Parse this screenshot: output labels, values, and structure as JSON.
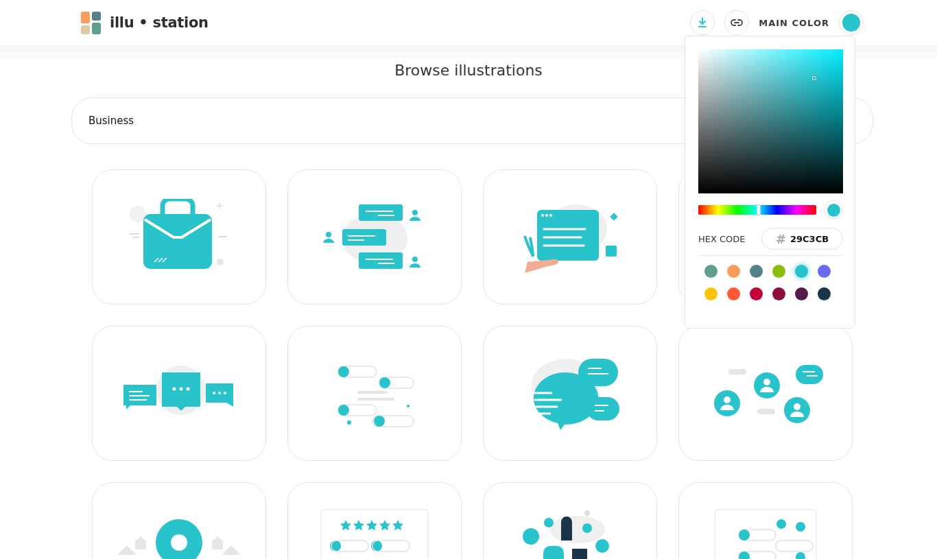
{
  "header": {
    "logo": {
      "word_1": "illu",
      "separator": "•",
      "word_2": "station"
    },
    "main_color_label": "MAIN COLOR"
  },
  "page_title": "Browse illustrations",
  "search": {
    "value": "Business"
  },
  "color_picker": {
    "saturation": {
      "level": 0.8
    },
    "brightness": {
      "level": 0.8
    },
    "hue": {
      "level": 0.51
    },
    "hex_label": "HEX CODE",
    "hash": "#",
    "hex_value": "29C3CB",
    "swatches": [
      {
        "color": "#5fa08d",
        "selected": false
      },
      {
        "color": "#f89e5a",
        "selected": false
      },
      {
        "color": "#56808a",
        "selected": false
      },
      {
        "color": "#8abd0a",
        "selected": false
      },
      {
        "color": "#29c3cb",
        "selected": true
      },
      {
        "color": "#6a6cf0",
        "selected": false
      },
      {
        "color": "#ffc20a",
        "selected": false
      },
      {
        "color": "#ff5a38",
        "selected": false
      },
      {
        "color": "#c60038",
        "selected": false
      },
      {
        "color": "#8d0e3c",
        "selected": false
      },
      {
        "color": "#561a46",
        "selected": false
      },
      {
        "color": "#1a3648",
        "selected": false
      }
    ]
  },
  "cards": [
    {
      "kind": "briefcase"
    },
    {
      "kind": "chat-people"
    },
    {
      "kind": "document-hand"
    },
    {
      "kind": "covered"
    },
    {
      "kind": "chat-three"
    },
    {
      "kind": "chat-list"
    },
    {
      "kind": "chat-big"
    },
    {
      "kind": "people-network"
    },
    {
      "kind": "location-pin"
    },
    {
      "kind": "rating-stars"
    },
    {
      "kind": "person-laptop"
    },
    {
      "kind": "chat-window"
    }
  ]
}
